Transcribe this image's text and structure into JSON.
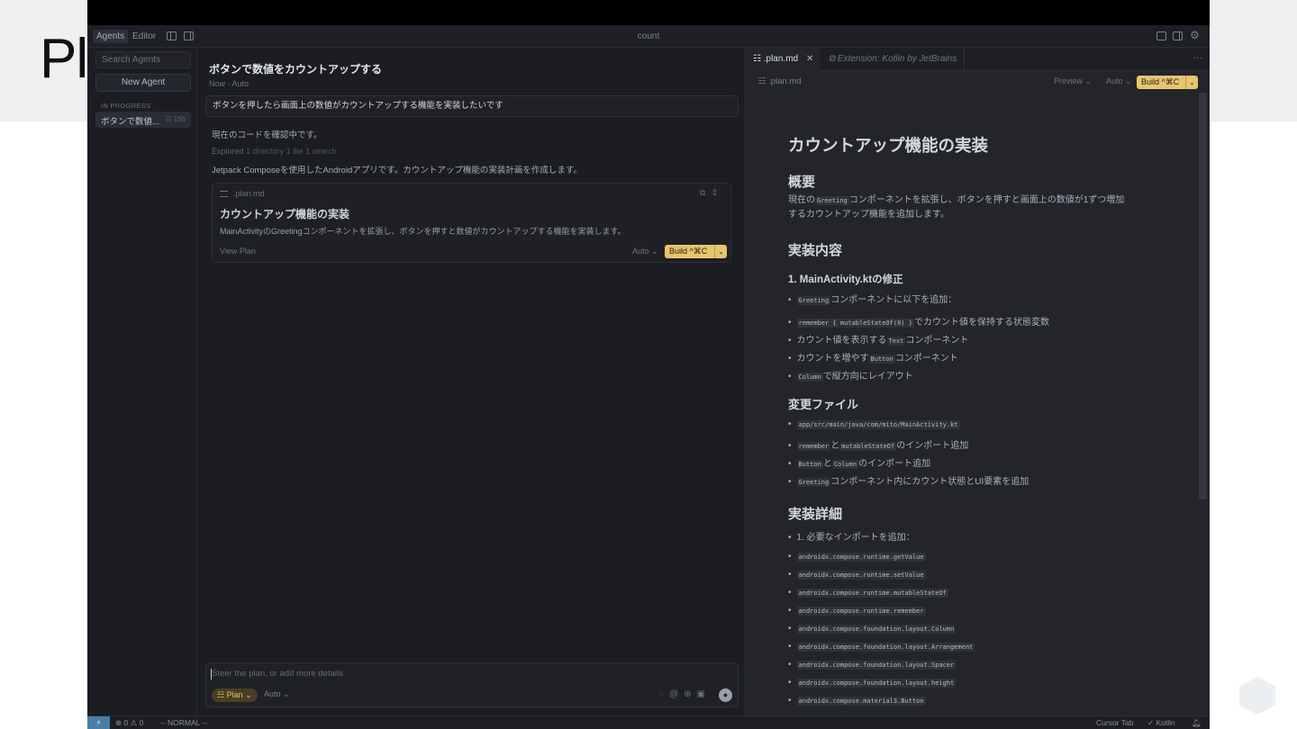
{
  "slide": {
    "title": "Pl"
  },
  "window": {
    "title": "count",
    "mode_tabs": [
      "Agents",
      "Editor"
    ]
  },
  "sidebar": {
    "search_placeholder": "Search Agents",
    "new_agent_label": "New Agent",
    "section_label": "IN PROGRESS",
    "items": [
      {
        "label": "ボタンで数値...",
        "age": "15h"
      }
    ]
  },
  "chat": {
    "title": "ボタンで数値をカウントアップする",
    "subtitle": "Now · Auto",
    "user_message": "ボタンを押したら画面上の数値がカウントアップする機能を実装したいです",
    "line1": "現在のコードを確認中です。",
    "explored_prefix": "Explored",
    "explored_detail": "1 directory 1 file 1 search",
    "line3": "Jetpack Composeを使用したAndroidアプリです。カウントアップ機能の実装計画を作成します。",
    "plan_card": {
      "file": ".plan.md",
      "title": "カウントアップ機能の実装",
      "description": "MainActivityのGreetingコンポーネントを拡張し、ボタンを押すと数値がカウントアップする機能を実装します。",
      "view_plan": "View Plan",
      "auto": "Auto",
      "build": "Build ^⌘C"
    },
    "composer": {
      "placeholder": "Steer the plan, or add more details",
      "plan_chip": "Plan",
      "auto_chip": "Auto"
    }
  },
  "editor": {
    "tabs": [
      {
        "label": ".plan.md",
        "active": true
      },
      {
        "label": "Extension: Kotlin by JetBrains",
        "active": false
      }
    ],
    "breadcrumb": ".plan.md",
    "preview": "Preview",
    "auto": "Auto",
    "build": "Build ^⌘C",
    "doc": {
      "h1": "カウントアップ機能の実装",
      "overview_heading": "概要",
      "overview_code": "Greeting",
      "overview_pre": "現在の",
      "overview_post": "コンポーネントを拡張し、ボタンを押すと画面上の数値が1ずつ増加",
      "overview_line2": "するカウントアップ機能を追加します。",
      "impl_heading": "実装内容",
      "step1_heading": "1. MainActivity.ktの修正",
      "step1_intro_code": "Greeting",
      "step1_intro_text": "コンポーネントに以下を追加：",
      "step1_items": [
        {
          "code": "remember { mutableStateOf(0) }",
          "text": "でカウント値を保持する状態変数"
        },
        {
          "pre": "カウント値を表示する",
          "code": "Text",
          "text": "コンポーネント"
        },
        {
          "pre": "カウントを増やす",
          "code": "Button",
          "text": "コンポーネント"
        },
        {
          "code": "Column",
          "text": "で縦方向にレイアウト"
        }
      ],
      "changes_heading": "変更ファイル",
      "changes_items": [
        {
          "code": "app/src/main/java/com/mito/MainActivity.kt",
          "text": ""
        },
        {
          "code": "remember",
          "mid": "と",
          "code2": "mutableStateOf",
          "text": "のインポート追加"
        },
        {
          "code": "Button",
          "mid": "と",
          "code2": "Column",
          "text": "のインポート追加"
        },
        {
          "code": "Greeting",
          "text": "コンポーネント内にカウント状態とUI要素を追加"
        }
      ],
      "details_heading": "実装詳細",
      "details_intro": "1. 必要なインポートを追加：",
      "imports": [
        "androidx.compose.runtime.getValue",
        "androidx.compose.runtime.setValue",
        "androidx.compose.runtime.mutableStateOf",
        "androidx.compose.runtime.remember",
        "androidx.compose.foundation.layout.Column",
        "androidx.compose.foundation.layout.Arrangement",
        "androidx.compose.foundation.layout.Spacer",
        "androidx.compose.foundation.layout.height",
        "androidx.compose.material3.Button"
      ]
    }
  },
  "status": {
    "errors": "0",
    "warnings": "0",
    "mode": "-- NORMAL --",
    "cursor_tab": "Cursor Tab",
    "language": "Kotlin"
  }
}
